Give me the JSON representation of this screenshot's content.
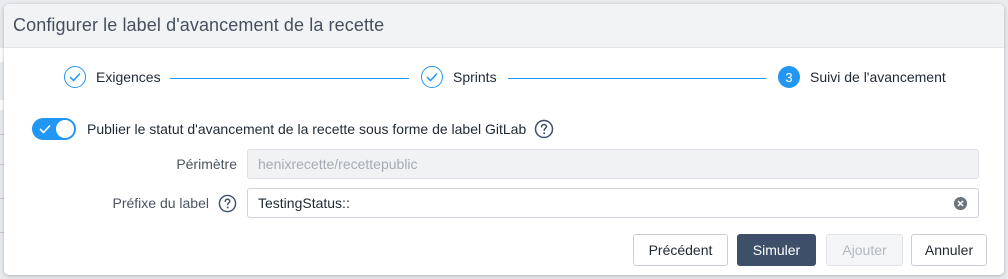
{
  "dialog": {
    "title": "Configurer le label d'avancement de la recette"
  },
  "stepper": {
    "steps": [
      {
        "label": "Exigences",
        "state": "done",
        "icon": "check-icon"
      },
      {
        "label": "Sprints",
        "state": "done",
        "icon": "check-icon"
      },
      {
        "label": "Suivi de l'avancement",
        "state": "active",
        "number": "3"
      }
    ]
  },
  "publish_toggle": {
    "label": "Publier le statut d'avancement de la recette sous forme de label GitLab",
    "checked": true,
    "help_icon": "question-circle-icon"
  },
  "form": {
    "perimetre": {
      "label": "Périmètre",
      "value": "henixrecette/recettepublic",
      "disabled": true
    },
    "prefixe": {
      "label": "Préfixe du label",
      "value": "TestingStatus::",
      "help_icon": "question-circle-icon",
      "clear_icon": "clear-circle-icon"
    }
  },
  "buttons": {
    "previous": "Précédent",
    "simulate": "Simuler",
    "add": "Ajouter",
    "cancel": "Annuler"
  },
  "colors": {
    "accent": "#2196f3",
    "primary_button": "#3d4f69",
    "header_bg": "#f1f3f5"
  }
}
